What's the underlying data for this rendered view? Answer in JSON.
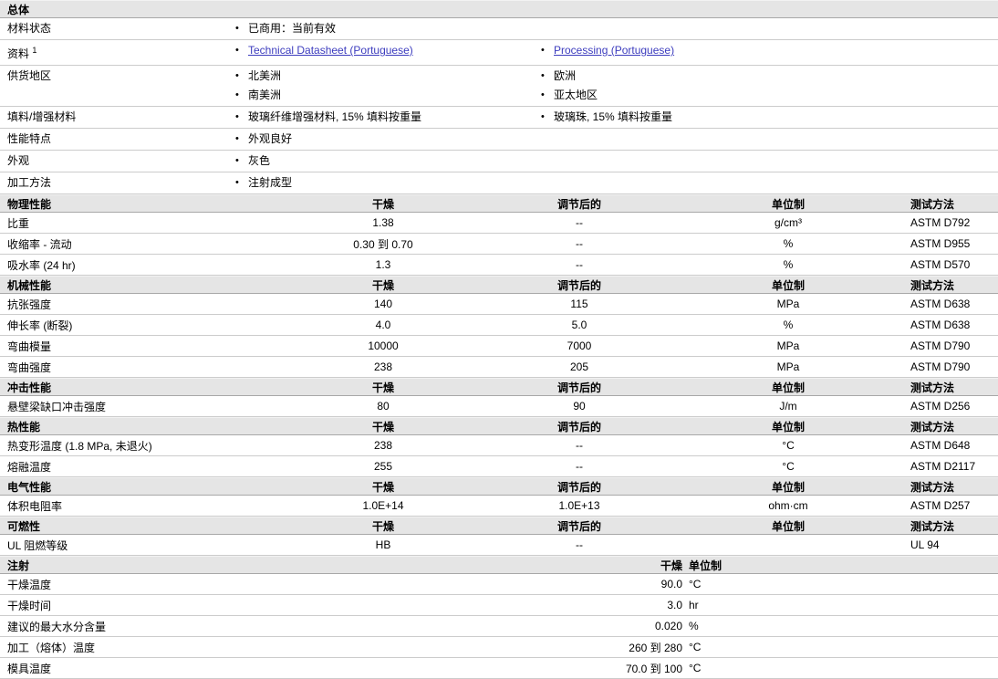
{
  "colors": {
    "link": "#3c3cbe",
    "band_bg": "#e5e5e5"
  },
  "column_headers": {
    "dry": "干燥",
    "cond": "调节后的",
    "unit": "单位制",
    "method": "测试方法"
  },
  "general": {
    "title": "总体",
    "rows": [
      {
        "label": "材料状态",
        "col1": [
          "已商用：当前有效"
        ],
        "col2": []
      },
      {
        "label": "资料",
        "sup": "1",
        "col1_links": [
          "Technical Datasheet (Portuguese)"
        ],
        "col2_links": [
          "Processing (Portuguese)"
        ]
      },
      {
        "label": "供货地区",
        "col1": [
          "北美洲",
          "南美洲"
        ],
        "col2": [
          "欧洲",
          "亚太地区"
        ]
      },
      {
        "label": "填料/增强材料",
        "col1": [
          "玻璃纤维增强材料, 15% 填料按重量"
        ],
        "col2": [
          "玻璃珠, 15% 填料按重量"
        ]
      },
      {
        "label": "性能特点",
        "col1": [
          "外观良好"
        ],
        "col2": []
      },
      {
        "label": "外观",
        "col1": [
          "灰色"
        ],
        "col2": []
      },
      {
        "label": "加工方法",
        "col1": [
          "注射成型"
        ],
        "col2": []
      }
    ]
  },
  "sections": [
    {
      "title": "物理性能",
      "rows": [
        {
          "label": "比重",
          "dry": "1.38",
          "cond": "--",
          "unit": "g/cm³",
          "method": "ASTM D792"
        },
        {
          "label": "收缩率 - 流动",
          "dry": "0.30 到 0.70",
          "cond": "--",
          "unit": "%",
          "method": "ASTM D955"
        },
        {
          "label": "吸水率 (24 hr)",
          "dry": "1.3",
          "cond": "--",
          "unit": "%",
          "method": "ASTM D570"
        }
      ]
    },
    {
      "title": "机械性能",
      "rows": [
        {
          "label": "抗张强度",
          "dry": "140",
          "cond": "115",
          "unit": "MPa",
          "method": "ASTM D638"
        },
        {
          "label": "伸长率 (断裂)",
          "dry": "4.0",
          "cond": "5.0",
          "unit": "%",
          "method": "ASTM D638"
        },
        {
          "label": "弯曲模量",
          "dry": "10000",
          "cond": "7000",
          "unit": "MPa",
          "method": "ASTM D790"
        },
        {
          "label": "弯曲强度",
          "dry": "238",
          "cond": "205",
          "unit": "MPa",
          "method": "ASTM D790"
        }
      ]
    },
    {
      "title": "冲击性能",
      "rows": [
        {
          "label": "悬壁梁缺口冲击强度",
          "dry": "80",
          "cond": "90",
          "unit": "J/m",
          "method": "ASTM D256"
        }
      ]
    },
    {
      "title": "热性能",
      "rows": [
        {
          "label": "热变形温度 (1.8 MPa, 未退火)",
          "dry": "238",
          "cond": "--",
          "unit": "°C",
          "method": "ASTM D648"
        },
        {
          "label": "熔融温度",
          "dry": "255",
          "cond": "--",
          "unit": "°C",
          "method": "ASTM D2117"
        }
      ]
    },
    {
      "title": "电气性能",
      "rows": [
        {
          "label": "体积电阻率",
          "dry": "1.0E+14",
          "cond": "1.0E+13",
          "unit": "ohm·cm",
          "method": "ASTM D257"
        }
      ]
    },
    {
      "title": "可燃性",
      "rows": [
        {
          "label": "UL 阻燃等级",
          "dry": "HB",
          "cond": "--",
          "unit": "",
          "method": "UL 94"
        }
      ]
    }
  ],
  "injection": {
    "title": "注射",
    "headers": {
      "dry": "干燥",
      "unit": "单位制"
    },
    "rows": [
      {
        "label": "干燥温度",
        "value": "90.0",
        "unit": "°C"
      },
      {
        "label": "干燥时间",
        "value": "3.0",
        "unit": "hr"
      },
      {
        "label": "建议的最大水分含量",
        "value": "0.020",
        "unit": "%"
      },
      {
        "label": "加工（熔体）温度",
        "value": "260 到 280",
        "unit": "°C"
      },
      {
        "label": "模具温度",
        "value": "70.0 到 100",
        "unit": "°C"
      }
    ]
  }
}
